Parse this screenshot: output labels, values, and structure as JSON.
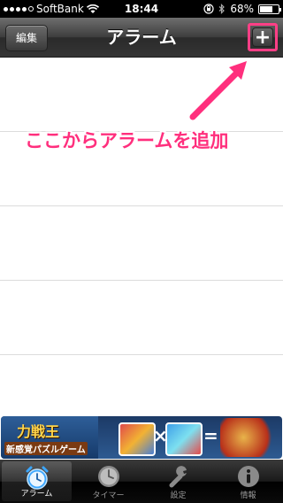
{
  "status": {
    "carrier": "SoftBank",
    "time": "18:44",
    "battery_percent": "68%",
    "battery_level": 0.68
  },
  "nav": {
    "edit_label": "編集",
    "title": "アラーム",
    "add_label": "+"
  },
  "annotation": {
    "text": "ここからアラームを追加",
    "color": "#ff2f7d"
  },
  "ad": {
    "logo_text": "力戦王",
    "caption": "新感覚パズルゲーム",
    "cross_symbol": "×",
    "equals_symbol": "="
  },
  "tabs": [
    {
      "label": "アラーム",
      "icon": "alarm-clock-icon",
      "active": true
    },
    {
      "label": "タイマー",
      "icon": "clock-icon",
      "active": false
    },
    {
      "label": "設定",
      "icon": "wrench-icon",
      "active": false
    },
    {
      "label": "情報",
      "icon": "info-icon",
      "active": false
    }
  ]
}
